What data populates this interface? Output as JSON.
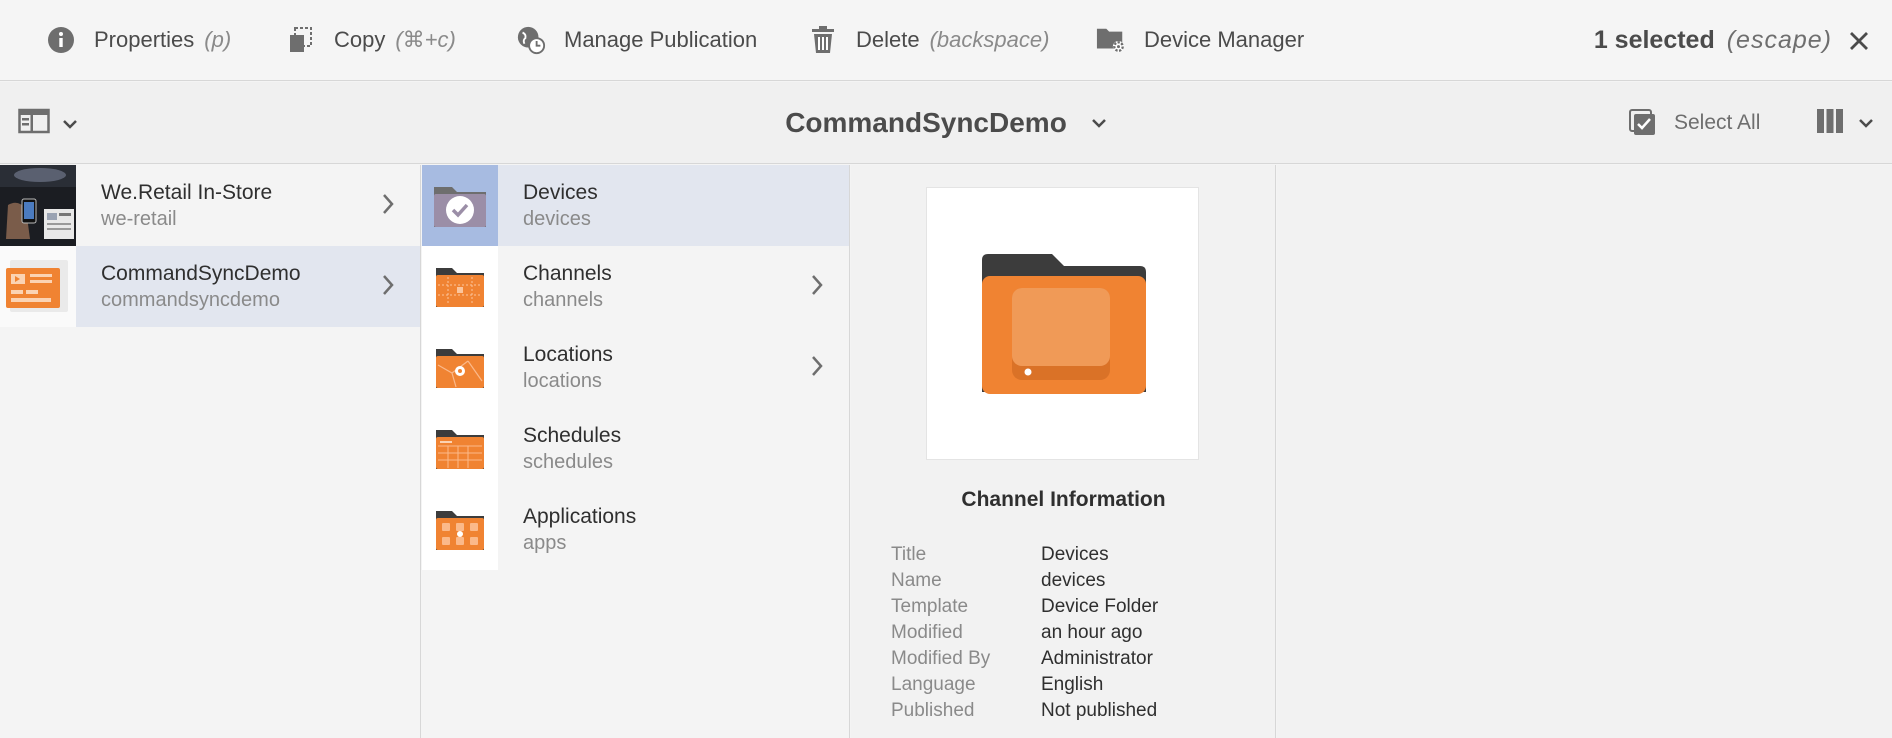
{
  "actionbar": {
    "actions": [
      {
        "label": "Properties",
        "kbd": "(p)"
      },
      {
        "label": "Copy",
        "kbd": "(⌘+c)"
      },
      {
        "label": "Manage Publication",
        "kbd": ""
      },
      {
        "label": "Delete",
        "kbd": "(backspace)"
      },
      {
        "label": "Device Manager",
        "kbd": ""
      }
    ],
    "selection": {
      "count_label": "1 selected",
      "escape_label": "(escape)"
    }
  },
  "titlebar": {
    "title": "CommandSyncDemo",
    "select_all": "Select All"
  },
  "columns": {
    "col1": [
      {
        "title": "We.Retail In-Store",
        "name": "we-retail"
      },
      {
        "title": "CommandSyncDemo",
        "name": "commandsyncdemo"
      }
    ],
    "col2": [
      {
        "title": "Devices",
        "name": "devices"
      },
      {
        "title": "Channels",
        "name": "channels"
      },
      {
        "title": "Locations",
        "name": "locations"
      },
      {
        "title": "Schedules",
        "name": "schedules"
      },
      {
        "title": "Applications",
        "name": "apps"
      }
    ]
  },
  "info": {
    "heading": "Channel Information",
    "rows": [
      {
        "k": "Title",
        "v": "Devices"
      },
      {
        "k": "Name",
        "v": "devices"
      },
      {
        "k": "Template",
        "v": "Device Folder"
      },
      {
        "k": "Modified",
        "v": "an hour ago"
      },
      {
        "k": "Modified By",
        "v": "Administrator"
      },
      {
        "k": "Language",
        "v": "English"
      },
      {
        "k": "Published",
        "v": "Not published"
      }
    ]
  },
  "colors": {
    "accent_orange": "#f08332",
    "folder_dark": "#3c3c3c",
    "selected_bg": "#e2e6ef"
  }
}
